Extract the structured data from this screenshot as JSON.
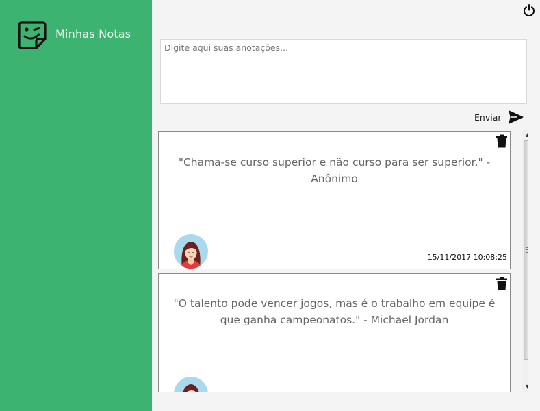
{
  "app": {
    "title": "Minhas Notas"
  },
  "sidebar": {
    "brand_icon": "sticky-note-smile-icon",
    "color": "#3cb371"
  },
  "header": {
    "power_icon": "power-icon"
  },
  "editor": {
    "placeholder": "Digite aqui suas anotações...",
    "value": ""
  },
  "send": {
    "label": "Enviar",
    "icon": "send-icon"
  },
  "notes": [
    {
      "text": "\"Chama-se curso superior e não curso para ser superior.\" - Anônimo",
      "timestamp": "15/11/2017 10:08:25",
      "avatar": "woman-avatar-icon",
      "delete_icon": "trash-icon"
    },
    {
      "text": "\"O talento pode vencer jogos, mas é o trabalho em equipe é que ganha campeonatos.\" - Michael Jordan",
      "timestamp": "",
      "avatar": "woman-avatar-icon",
      "delete_icon": "trash-icon"
    }
  ],
  "scrollbar": {
    "up_glyph": "▲",
    "down_glyph": "▼"
  }
}
